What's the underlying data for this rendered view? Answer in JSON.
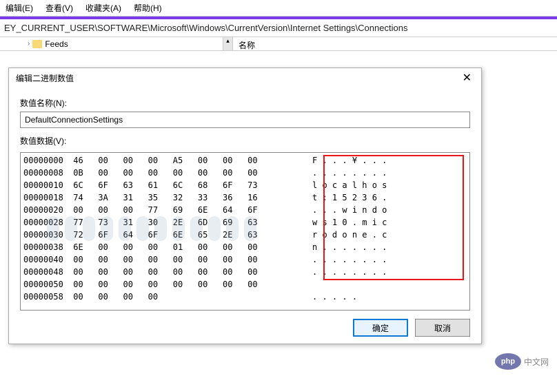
{
  "menubar": {
    "items": [
      "编辑(E)",
      "查看(V)",
      "收藏夹(A)",
      "帮助(H)"
    ]
  },
  "addressbar": {
    "path": "EY_CURRENT_USER\\SOFTWARE\\Microsoft\\Windows\\CurrentVersion\\Internet Settings\\Connections"
  },
  "tree": {
    "item0": "Feeds"
  },
  "list": {
    "header": "名称"
  },
  "dialog": {
    "title": "编辑二进制数值",
    "name_label": "数值名称(N):",
    "name_value": "DefaultConnectionSettings",
    "data_label": "数值数据(V):",
    "ok": "确定",
    "cancel": "取消"
  },
  "hex": {
    "rows": [
      {
        "addr": "00000000",
        "b": [
          "46",
          "00",
          "00",
          "00",
          "A5",
          "00",
          "00",
          "00"
        ],
        "t": "F . . . ¥ . . ."
      },
      {
        "addr": "00000008",
        "b": [
          "0B",
          "00",
          "00",
          "00",
          "00",
          "00",
          "00",
          "00"
        ],
        "t": ". . . . . . . ."
      },
      {
        "addr": "00000010",
        "b": [
          "6C",
          "6F",
          "63",
          "61",
          "6C",
          "68",
          "6F",
          "73"
        ],
        "t": "l o c a l h o s"
      },
      {
        "addr": "00000018",
        "b": [
          "74",
          "3A",
          "31",
          "35",
          "32",
          "33",
          "36",
          "16"
        ],
        "t": "t : 1 5 2 3 6 ."
      },
      {
        "addr": "00000020",
        "b": [
          "00",
          "00",
          "00",
          "77",
          "69",
          "6E",
          "64",
          "6F"
        ],
        "t": ". . . w i n d o"
      },
      {
        "addr": "00000028",
        "b": [
          "77",
          "73",
          "31",
          "30",
          "2E",
          "6D",
          "69",
          "63"
        ],
        "t": "w s 1 0 . m i c"
      },
      {
        "addr": "00000030",
        "b": [
          "72",
          "6F",
          "64",
          "6F",
          "6E",
          "65",
          "2E",
          "63"
        ],
        "t": "r o d o n e . c"
      },
      {
        "addr": "00000038",
        "b": [
          "6E",
          "00",
          "00",
          "00",
          "01",
          "00",
          "00",
          "00"
        ],
        "t": "n . . . . . . ."
      },
      {
        "addr": "00000040",
        "b": [
          "00",
          "00",
          "00",
          "00",
          "00",
          "00",
          "00",
          "00"
        ],
        "t": ". . . . . . . ."
      },
      {
        "addr": "00000048",
        "b": [
          "00",
          "00",
          "00",
          "00",
          "00",
          "00",
          "00",
          "00"
        ],
        "t": ". . . . . . . ."
      },
      {
        "addr": "00000050",
        "b": [
          "00",
          "00",
          "00",
          "00",
          "00",
          "00",
          "00",
          "00"
        ],
        "t": ""
      },
      {
        "addr": "00000058",
        "b": [
          "00",
          "00",
          "00",
          "00",
          "",
          "",
          "",
          ""
        ],
        "t": ". . . . ."
      }
    ]
  },
  "logo": {
    "ball": "php",
    "text": "中文网"
  }
}
